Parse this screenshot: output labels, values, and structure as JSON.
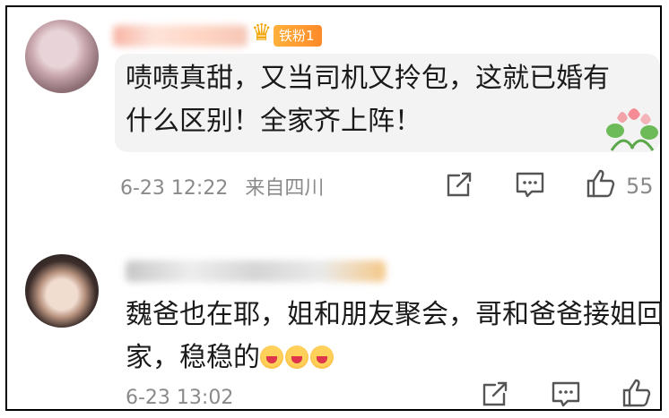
{
  "comments": [
    {
      "badge": "铁粉1",
      "text": "啧啧真甜，又当司机又拎包，这就已婚有什么区别！全家齐上阵！",
      "timestamp": "6-23 12:22",
      "location": "来自四川",
      "likes": "55"
    },
    {
      "text": "魏爸也在耶，姐和朋友聚会，哥和爸爸接姐回家，稳稳的",
      "emojis": [
        "heart-eyes-emoji",
        "heart-eyes-emoji",
        "heart-eyes-emoji"
      ],
      "timestamp": "6-23 13:02"
    }
  ],
  "icons": {
    "share": "share-icon",
    "comment": "comment-icon",
    "like": "thumbs-up-icon",
    "decoration": "tulip-sticker"
  },
  "colors": {
    "text": "#1a1a1a",
    "meta": "#8a8a8a",
    "badge": "#ff9a2e",
    "bubble": "#f3f3f3"
  }
}
